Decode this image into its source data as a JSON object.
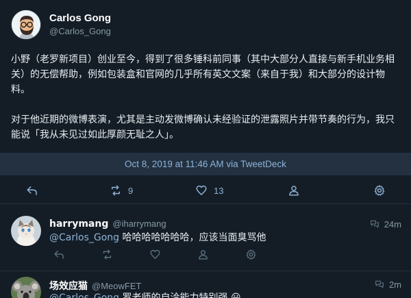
{
  "tweet": {
    "author_name": "Carlos Gong",
    "author_handle": "@Carlos_Gong",
    "avatar_icon": "bearded-man-glasses-avatar",
    "paragraph_1": "小野（老罗新项目）创业至今，得到了很多锤科前同事（其中大部分人直接与新手机业务相关）的无偿帮助，例如包装盒和官网的几乎所有英文文案（来自于我）和大部分的设计物料。",
    "paragraph_2": "对于他近期的微博表演，尤其是主动发微博确认未经验证的泄露照片并带节奏的行为，我只能说「我从未见过如此厚颜无耻之人」。",
    "timestamp": "Oct 8, 2019 at 11:46 AM via TweetDeck",
    "actions": {
      "reply_icon": "reply-icon",
      "retweet_icon": "retweet-icon",
      "retweet_count": "9",
      "like_icon": "heart-icon",
      "like_count": "13",
      "profile_icon": "person-icon",
      "settings_icon": "gear-icon"
    }
  },
  "replies": [
    {
      "name": "harrymang",
      "handle": "@iharrymang",
      "time": "24m",
      "mention": "@Carlos_Gong",
      "text": " 哈哈哈哈哈哈哈，应该当面臭骂他",
      "avatar_icon": "cat-avatar"
    },
    {
      "name": "场效应猫",
      "handle": "@MeowFET",
      "time": "2m",
      "mention": "@Carlos_Gong",
      "text": " 罗老师的自洽能力特别强 😀",
      "avatar_icon": "koala-avatar"
    }
  ],
  "colors": {
    "background": "#141d26",
    "accent": "#8fb3d6",
    "timestamp_bar": "#233141",
    "muted": "#8899a6"
  }
}
